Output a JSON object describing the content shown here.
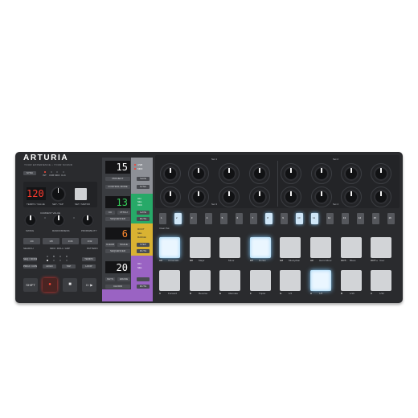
{
  "brand": {
    "name": "ARTURIA",
    "tagline": "YOUR EXPERIENCE • YOUR SOUND"
  },
  "colors": {
    "body": "#2a2b2e",
    "display_red": "#ff3a2e",
    "display_green": "#35d15b",
    "pad_lit": "#cfe6f7",
    "panel_grey": "#a9acb1",
    "panel_green": "#27a968",
    "panel_yellow": "#d9b232",
    "panel_purple": "#9a63c3",
    "play_red": "#e5342c"
  },
  "left": {
    "sync": "SYNC",
    "sync_options": [
      "INT",
      "USB",
      "MIDI",
      "CLK"
    ],
    "tempo_display": "120",
    "tempo_label": "TEMPO / VALUE",
    "knob_label": "SET / TAP",
    "set_button_label": "SET / METRO",
    "knobs": [
      "SWING",
      "CURRENT VALUE",
      "RANDOMNESS",
      "PROBABILITY"
    ],
    "mode_buttons": [
      "1/4",
      "1/8",
      "1/16",
      "1/32"
    ],
    "mode_caption_left": "SEARCH",
    "mode_caption_mid": "MIDI / ROLL / ARP",
    "mode_caption_right": "PATTERN",
    "row1": [
      "SEQ / MODE",
      "REC",
      "TEMPO"
    ],
    "row2": [
      "PROJ / CONT",
      "HOLD",
      "TAP",
      "LOOP"
    ],
    "row1_led_labels": [
      "A",
      "B",
      "C",
      "D"
    ],
    "transport": [
      "SHIFT",
      "●",
      "■",
      "II / ▶"
    ]
  },
  "panels": {
    "p1": {
      "display": "15",
      "buttons": [
        "PROJECT",
        "SAVE",
        "CONTROL MODE",
        "SYNC",
        "SEQUENCER"
      ],
      "leds": [
        "USB",
        "MIDI"
      ]
    },
    "p2": {
      "display": "13",
      "buttons": [
        "CC",
        "PITCH",
        "GATE",
        "RANGE",
        "SEQUENCER",
        "MUTE"
      ],
      "leds": [
        "ON",
        "SEL",
        "OFF"
      ]
    },
    "p3": {
      "display": "6",
      "buttons": [
        "CLEAR",
        "SCALE",
        "SEQUENCER",
        "STEP",
        "SEQUENCER",
        "MUTE"
      ],
      "leds": [
        "ROOT",
        "SEL",
        "RANGE"
      ]
    },
    "p4": {
      "display": "20",
      "buttons": [
        "KEYS",
        "ERASE",
        "CHORD",
        "MUTE"
      ],
      "leds": [
        "ON",
        "SEL"
      ]
    }
  },
  "encoders": {
    "set1": "Set 1",
    "set2": "Set 2",
    "set3": "Set 3",
    "set4": "Set 4"
  },
  "steps": {
    "numbers": [
      "1",
      "2",
      "3",
      "4",
      "5",
      "6",
      "7",
      "8",
      "9",
      "10",
      "11",
      "12",
      "13",
      "14",
      "15",
      "16"
    ],
    "lit": [
      2,
      8,
      10,
      11
    ],
    "caption": "Clear Pat"
  },
  "pads_top": [
    {
      "note": "C#",
      "label": "Chromatic",
      "lit": true
    },
    {
      "note": "D#",
      "label": "Major",
      "lit": false
    },
    {
      "note": "",
      "label": "Minor",
      "lit": false
    },
    {
      "note": "F#",
      "label": "Dorian",
      "lit": true
    },
    {
      "note": "G#",
      "label": "Mixolydian",
      "lit": false
    },
    {
      "note": "A#",
      "label": "Harm Minor",
      "lit": false
    },
    {
      "note": "OCT -",
      "label": "Blues",
      "lit": false
    },
    {
      "note": "OCT +",
      "label": "User",
      "lit": false
    }
  ],
  "pads_bottom": [
    {
      "note": "C",
      "label": "Forward",
      "lit": false
    },
    {
      "note": "D",
      "label": "Reverse",
      "lit": false
    },
    {
      "note": "E",
      "label": "Alternate",
      "lit": false
    },
    {
      "note": "F",
      "label": "Triplet",
      "lit": false
    },
    {
      "note": "G",
      "label": "1/4",
      "lit": false
    },
    {
      "note": "A",
      "label": "1/8",
      "lit": true
    },
    {
      "note": "B",
      "label": "1/16",
      "lit": false
    },
    {
      "note": "C",
      "label": "1/32",
      "lit": false
    }
  ]
}
